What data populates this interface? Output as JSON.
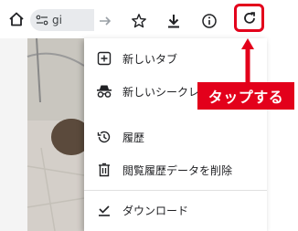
{
  "toolbar": {
    "url_text": "gi"
  },
  "menu": {
    "items": [
      {
        "label": "新しいタブ",
        "icon": "new-tab-icon"
      },
      {
        "label": "新しいシークレ",
        "icon": "incognito-icon"
      },
      {
        "label": "履歴",
        "icon": "history-icon"
      },
      {
        "label": "閲覧履歴データを削除",
        "icon": "delete-icon"
      },
      {
        "label": "ダウンロード",
        "icon": "download-done-icon"
      }
    ]
  },
  "annotation": {
    "callout_text": "タップする",
    "color": "#e3001b"
  }
}
